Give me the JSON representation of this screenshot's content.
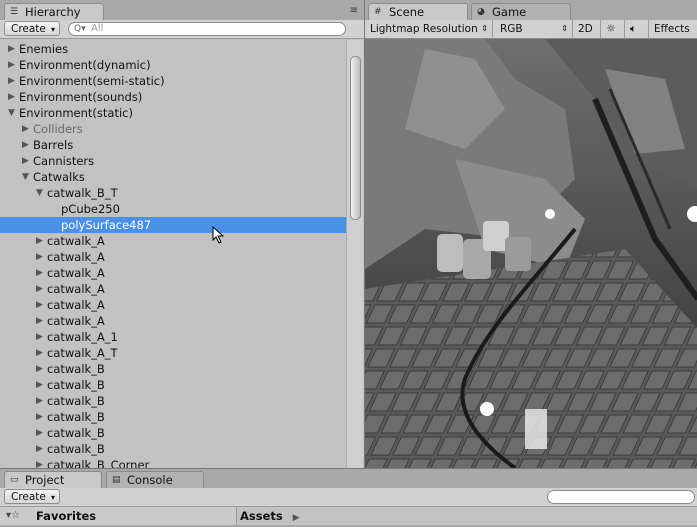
{
  "hierarchy": {
    "tab_label": "Hierarchy",
    "create_label": "Create",
    "search_placeholder": "All",
    "items": [
      {
        "label": "Enemies",
        "arrow": "▶",
        "depth": 0
      },
      {
        "label": "Environment(dynamic)",
        "arrow": "▶",
        "depth": 0
      },
      {
        "label": "Environment(semi-static)",
        "arrow": "▶",
        "depth": 0
      },
      {
        "label": "Environment(sounds)",
        "arrow": "▶",
        "depth": 0
      },
      {
        "label": "Environment(static)",
        "arrow": "▼",
        "depth": 0
      },
      {
        "label": "Colliders",
        "arrow": "▶",
        "depth": 1,
        "muted": true
      },
      {
        "label": "Barrels",
        "arrow": "▶",
        "depth": 1
      },
      {
        "label": "Cannisters",
        "arrow": "▶",
        "depth": 1
      },
      {
        "label": "Catwalks",
        "arrow": "▼",
        "depth": 1
      },
      {
        "label": "catwalk_B_T",
        "arrow": "▼",
        "depth": 2
      },
      {
        "label": "pCube250",
        "arrow": "",
        "depth": 3
      },
      {
        "label": "polySurface487",
        "arrow": "",
        "depth": 3,
        "selected": true
      },
      {
        "label": "catwalk_A",
        "arrow": "▶",
        "depth": 2
      },
      {
        "label": "catwalk_A",
        "arrow": "▶",
        "depth": 2
      },
      {
        "label": "catwalk_A",
        "arrow": "▶",
        "depth": 2
      },
      {
        "label": "catwalk_A",
        "arrow": "▶",
        "depth": 2
      },
      {
        "label": "catwalk_A",
        "arrow": "▶",
        "depth": 2
      },
      {
        "label": "catwalk_A",
        "arrow": "▶",
        "depth": 2
      },
      {
        "label": "catwalk_A_1",
        "arrow": "▶",
        "depth": 2
      },
      {
        "label": "catwalk_A_T",
        "arrow": "▶",
        "depth": 2
      },
      {
        "label": "catwalk_B",
        "arrow": "▶",
        "depth": 2
      },
      {
        "label": "catwalk_B",
        "arrow": "▶",
        "depth": 2
      },
      {
        "label": "catwalk_B",
        "arrow": "▶",
        "depth": 2
      },
      {
        "label": "catwalk_B",
        "arrow": "▶",
        "depth": 2
      },
      {
        "label": "catwalk_B",
        "arrow": "▶",
        "depth": 2
      },
      {
        "label": "catwalk_B",
        "arrow": "▶",
        "depth": 2
      },
      {
        "label": "catwalk_B_Corner",
        "arrow": "▶",
        "depth": 2
      }
    ]
  },
  "scene": {
    "tab_scene": "Scene",
    "tab_game": "Game",
    "render_mode": "Lightmap Resolution",
    "color_mode": "RGB",
    "mode_2d": "2D",
    "effects": "Effects"
  },
  "bottom": {
    "tab_project": "Project",
    "tab_console": "Console",
    "create_label": "Create",
    "favorites_label": "Favorites",
    "assets_label": "Assets"
  },
  "colors": {
    "selection": "#4a90e6",
    "panel_bg": "#c2c2c2"
  },
  "icons": [
    "hierarchy-icon",
    "menu-icon",
    "search-icon",
    "grid-icon",
    "pacman-icon",
    "sun-icon",
    "speaker-icon",
    "star-icon",
    "arrow-right-icon"
  ]
}
